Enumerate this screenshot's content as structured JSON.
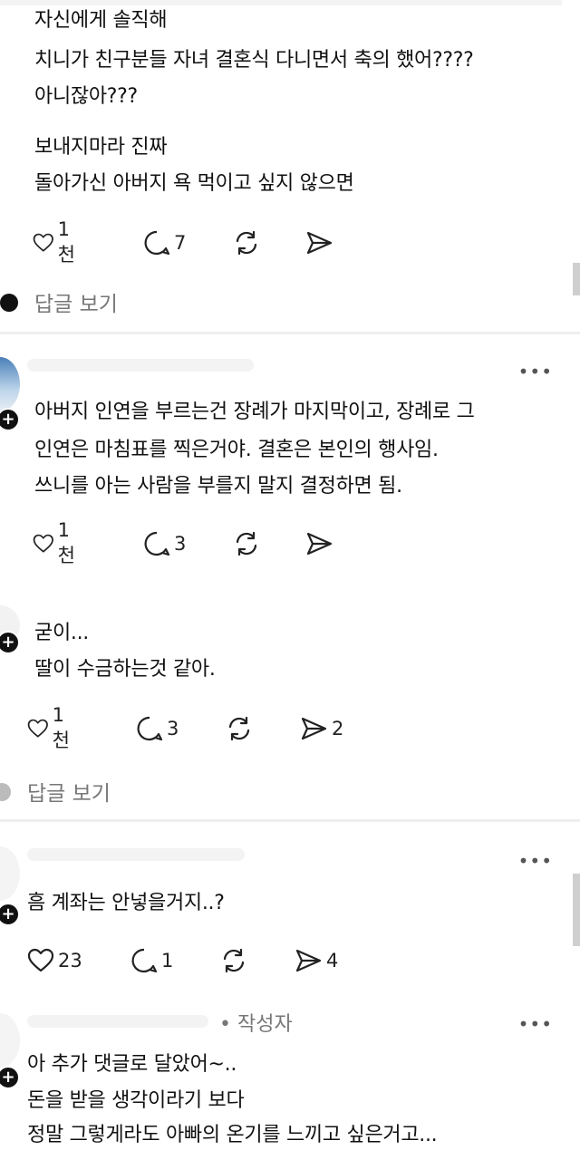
{
  "comment1": {
    "lines": [
      "자신에게 솔직해",
      "치니가 친구분들 자녀 결혼식 다니면서 축의 했어????",
      "아니잖아???"
    ],
    "lines2": [
      "보내지마라 진짜",
      "돌아가신 아버지 욕 먹이고 싶지 않으면"
    ],
    "actions": {
      "likes": "1천",
      "replies": "7",
      "reposts": "",
      "shares": ""
    },
    "view_replies": "답글 보기"
  },
  "comment2": {
    "lines": [
      "아버지 인연을 부르는건 장례가 마지막이고, 장례로 그",
      "인연은 마침표를 찍은거야. 결혼은 본인의 행사임.",
      "쓰니를 아는 사람을 부를지 말지 결정하면 됨."
    ],
    "actions": {
      "likes": "1천",
      "replies": "3",
      "reposts": "",
      "shares": ""
    }
  },
  "comment3": {
    "lines": [
      "굳이...",
      "딸이 수금하는것 같아."
    ],
    "actions": {
      "likes": "1천",
      "replies": "3",
      "reposts": "",
      "shares": "2"
    },
    "view_replies": "답글 보기"
  },
  "comment4": {
    "lines": [
      "흠 계좌는 안넣을거지..?"
    ],
    "actions": {
      "likes": "23",
      "replies": "1",
      "reposts": "",
      "shares": "4"
    }
  },
  "comment5": {
    "author_badge": "• 작성자",
    "lines": [
      "아 추가 댓글로 달았어~..",
      "돈을 받을 생각이라기 보다",
      "정말 그렇게라도 아빠의 온기를 느끼고 싶은거고..."
    ]
  },
  "more_label": "•••",
  "colors": {
    "text": "#111111",
    "muted": "#777777",
    "divider": "#eeeeee"
  }
}
